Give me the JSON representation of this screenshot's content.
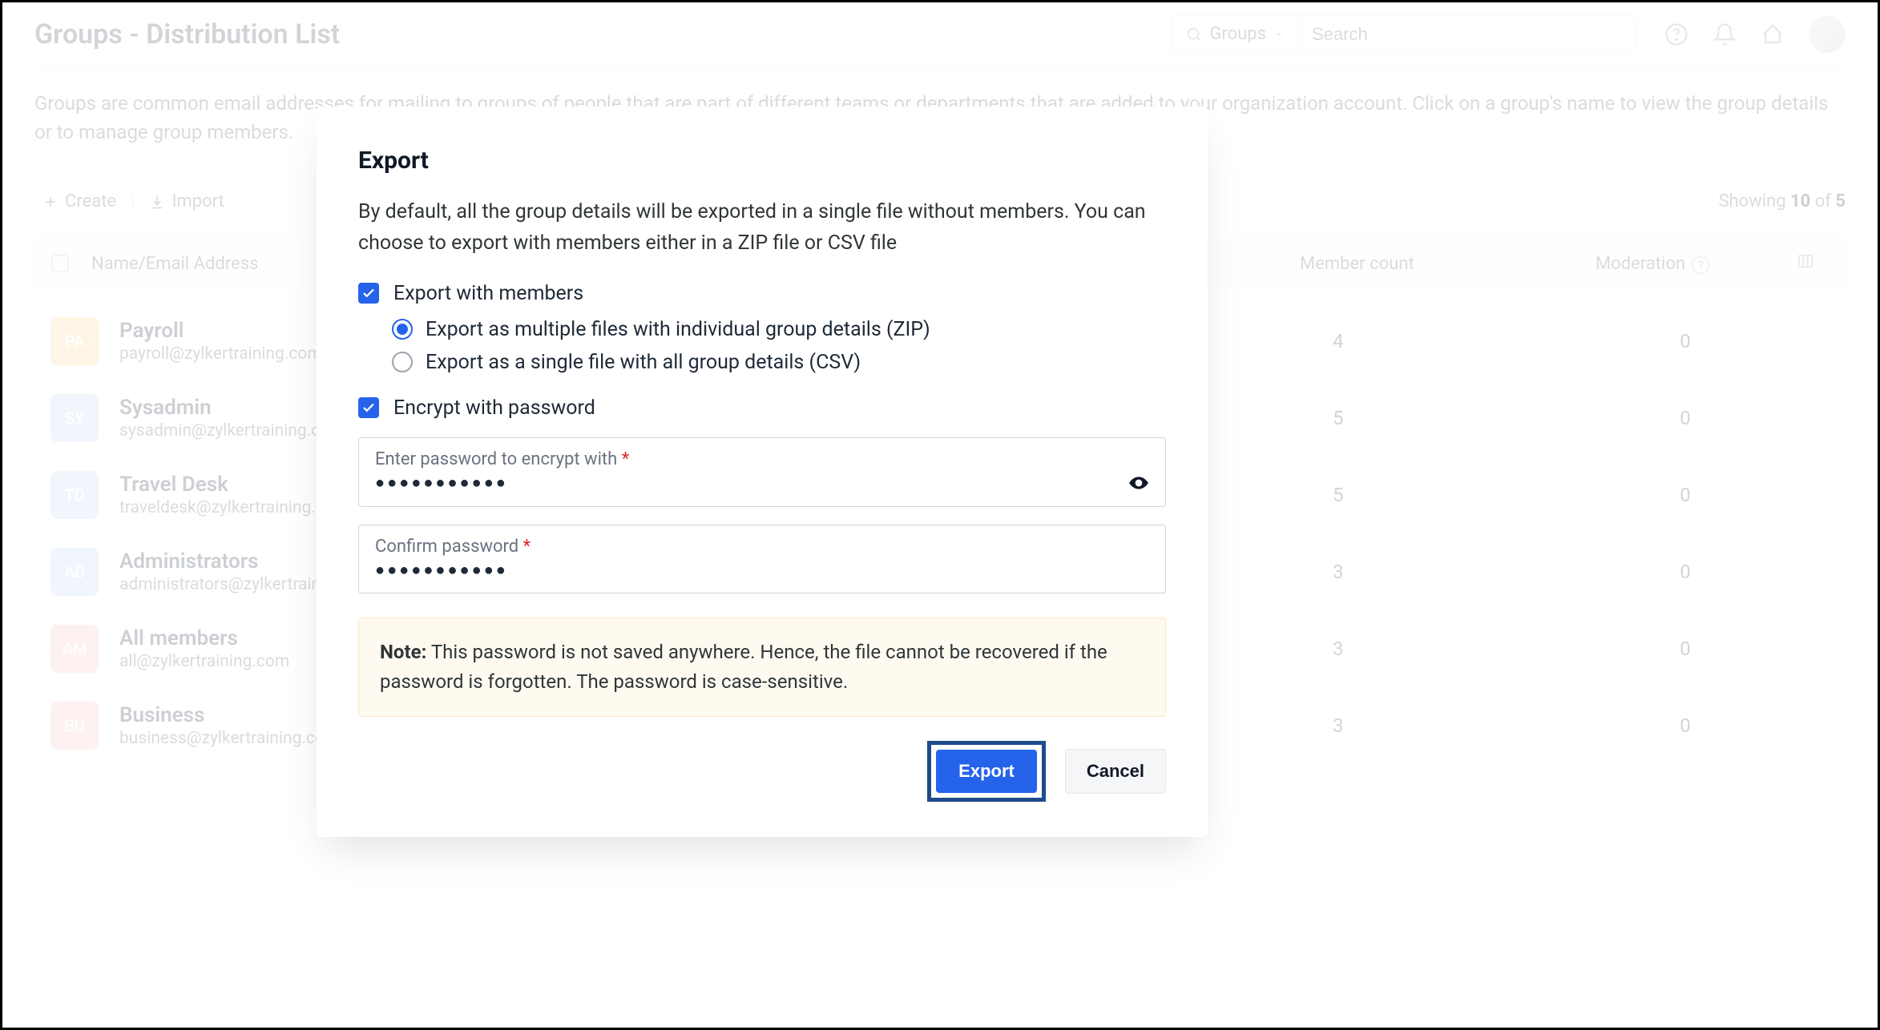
{
  "header": {
    "title": "Groups - Distribution List",
    "search_type": "Groups",
    "search_placeholder": "Search"
  },
  "page": {
    "description": "Groups are common email addresses for mailing to groups of people that are part of different teams or departments that are added to your organization account. Click on a group's name to view the group details or to manage group members.",
    "create_label": "Create",
    "import_label": "Import",
    "showing_prefix": "Showing ",
    "showing_count": "10",
    "showing_of": " of ",
    "showing_total": "5"
  },
  "columns": {
    "name": "Name/Email Address",
    "count": "Member count",
    "moderation": "Moderation"
  },
  "rows": [
    {
      "abbr": "PA",
      "color": "#fbd89c",
      "name": "Payroll",
      "email": "payroll@zylkertraining.com",
      "count": "4",
      "mod": "0"
    },
    {
      "abbr": "SY",
      "color": "#c6d9f8",
      "name": "Sysadmin",
      "email": "sysadmin@zylkertraining.com",
      "count": "5",
      "mod": "0"
    },
    {
      "abbr": "TD",
      "color": "#c6d9f8",
      "name": "Travel Desk",
      "email": "traveldesk@zylkertraining.com",
      "count": "5",
      "mod": "0"
    },
    {
      "abbr": "AD",
      "color": "#c6d9f8",
      "name": "Administrators",
      "email": "administrators@zylkertraining.com",
      "count": "3",
      "mod": "0"
    },
    {
      "abbr": "AM",
      "color": "#f6c7c7",
      "name": "All members",
      "email": "all@zylkertraining.com",
      "count": "3",
      "mod": "0"
    },
    {
      "abbr": "BU",
      "color": "#f6c7c7",
      "name": "Business",
      "email": "business@zylkertraining.com",
      "count": "3",
      "mod": "0"
    }
  ],
  "modal": {
    "title": "Export",
    "description": "By default, all the group details will be exported in a single file without members. You can choose to export with members either in a ZIP file or CSV file",
    "export_with_members": "Export with members",
    "radio_zip": "Export as multiple files with individual group details (ZIP)",
    "radio_csv": "Export as a single file with all group details (CSV)",
    "encrypt": "Encrypt with password",
    "password_label": "Enter password to encrypt with",
    "password_value": "●●●●●●●●●●●",
    "confirm_label": "Confirm password",
    "confirm_value": "●●●●●●●●●●●",
    "note_label": "Note:",
    "note_text": " This password is not saved anywhere. Hence, the file cannot be recovered if the password is forgotten. The password is case-sensitive.",
    "export_btn": "Export",
    "cancel_btn": "Cancel"
  }
}
